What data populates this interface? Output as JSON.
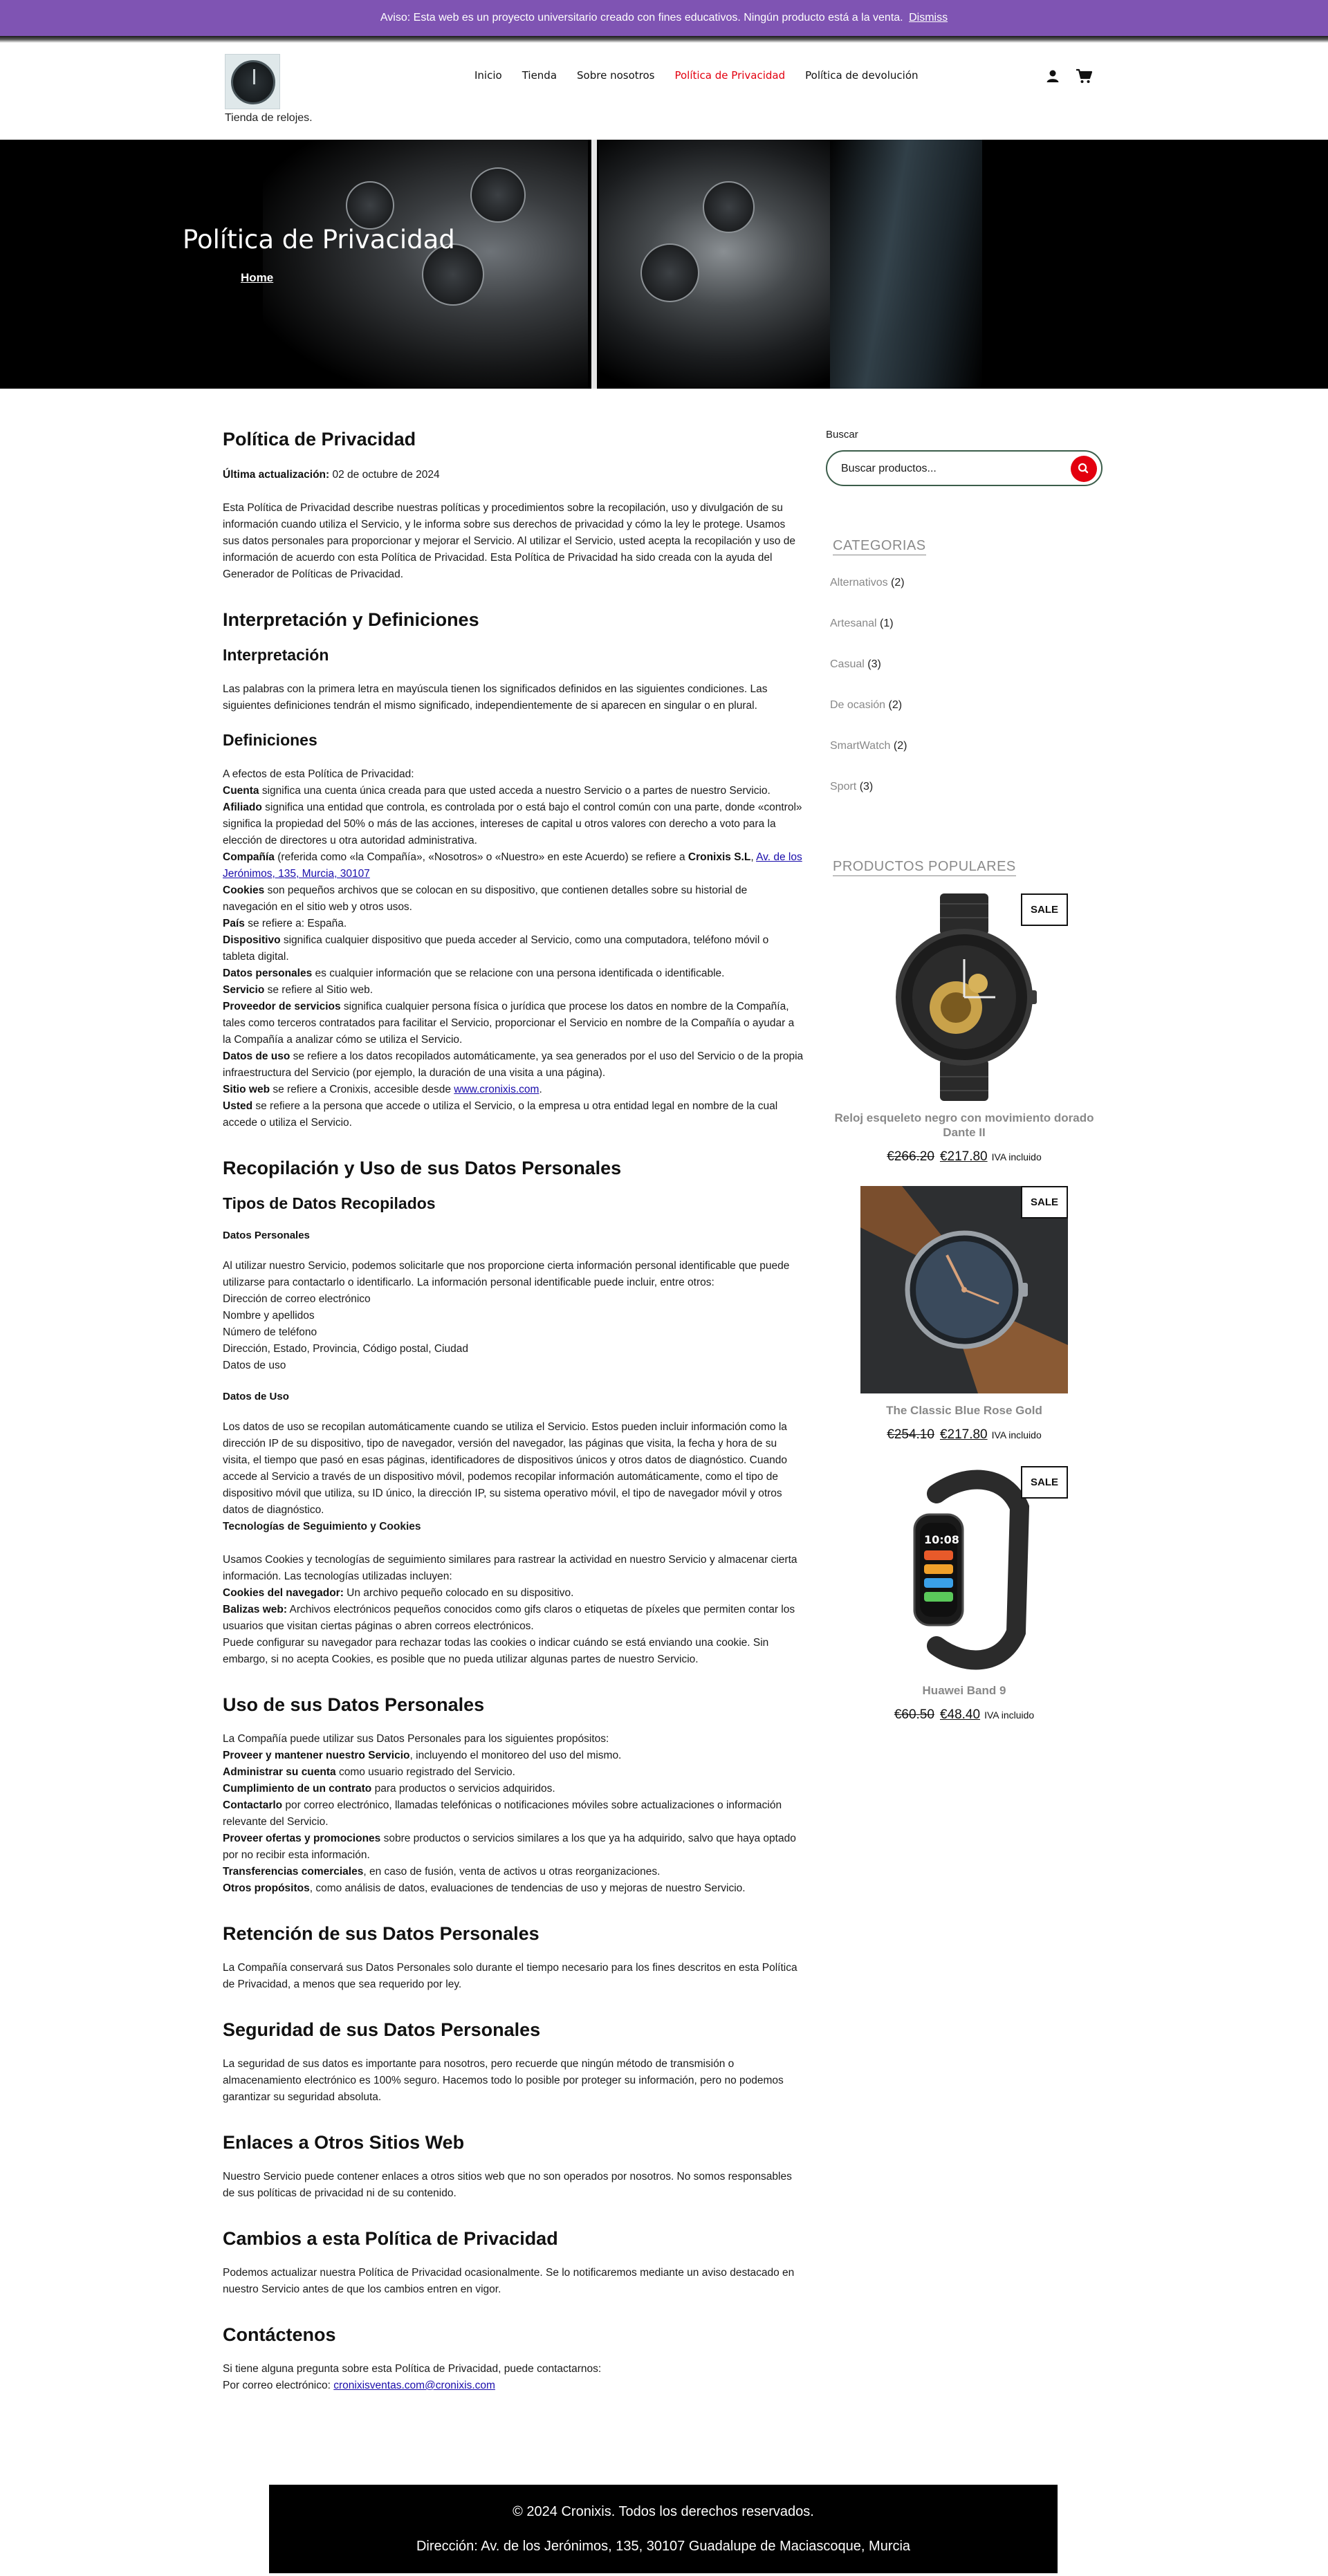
{
  "notice": {
    "text": "Aviso: Esta web es un proyecto universitario creado con fines educativos. Ningún producto está a la venta.",
    "dismiss": "Dismiss"
  },
  "header": {
    "tagline": "Tienda de relojes.",
    "nav": [
      "Inicio",
      "Tienda",
      "Sobre nosotros",
      "Política de Privacidad",
      "Política de devolución"
    ],
    "active_nav": "Política de Privacidad",
    "icons": [
      "user-icon",
      "cart-icon"
    ]
  },
  "hero": {
    "title": "Política de Privacidad",
    "breadcrumb": "Home"
  },
  "article": {
    "title": "Política de Privacidad",
    "last_update_label": "Última actualización:",
    "last_update_value": " 02 de octubre de 2024",
    "intro": "Esta Política de Privacidad describe nuestras políticas y procedimientos sobre la recopilación, uso y divulgación de su información cuando utiliza el Servicio, y le informa sobre sus derechos de privacidad y cómo la ley le protege. Usamos sus datos personales para proporcionar y mejorar el Servicio. Al utilizar el Servicio, usted acepta la recopilación y uso de información de acuerdo con esta Política de Privacidad. Esta Política de Privacidad ha sido creada con la ayuda del Generador de Políticas de Privacidad.",
    "s_interp": "Interpretación y Definiciones",
    "s_interp_sub": "Interpretación",
    "interp_text": "Las palabras con la primera letra en mayúscula tienen los significados definidos en las siguientes condiciones. Las siguientes definiciones tendrán el mismo significado, independientemente de si aparecen en singular o en plural.",
    "s_defs": "Definiciones",
    "defs_intro": "A efectos de esta Política de Privacidad:",
    "defs": {
      "cuenta_t": "Cuenta",
      "cuenta_d": " significa una cuenta única creada para que usted acceda a nuestro Servicio o a partes de nuestro Servicio.",
      "afiliado_t": "Afiliado",
      "afiliado_d": " significa una entidad que controla, es controlada por o está bajo el control común con una parte, donde «control» significa la propiedad del 50% o más de las acciones, intereses de capital u otros valores con derecho a voto para la elección de directores u otra autoridad administrativa.",
      "compania_t": "Compañía",
      "compania_d": " (referida como «la Compañía», «Nosotros» o «Nuestro» en este Acuerdo) se refiere a ",
      "compania_name": "Cronixis S.L",
      "compania_addr": "Av. de los Jerónimos, 135, Murcia, 30107",
      "cookies_t": "Cookies",
      "cookies_d": " son pequeños archivos que se colocan en su dispositivo, que contienen detalles sobre su historial de navegación en el sitio web y otros usos.",
      "pais_t": "País",
      "pais_d": " se refiere a: España.",
      "dispositivo_t": "Dispositivo",
      "dispositivo_d": " significa cualquier dispositivo que pueda acceder al Servicio, como una computadora, teléfono móvil o tableta digital.",
      "datos_t": "Datos personales",
      "datos_d": " es cualquier información que se relacione con una persona identificada o identificable.",
      "servicio_t": "Servicio",
      "servicio_d": " se refiere al Sitio web.",
      "proveedor_t": "Proveedor de servicios",
      "proveedor_d": " significa cualquier persona física o jurídica que procese los datos en nombre de la Compañía, tales como terceros contratados para facilitar el Servicio, proporcionar el Servicio en nombre de la Compañía o ayudar a la Compañía a analizar cómo se utiliza el Servicio.",
      "uso_t": "Datos de uso",
      "uso_d": " se refiere a los datos recopilados automáticamente, ya sea generados por el uso del Servicio o de la propia infraestructura del Servicio (por ejemplo, la duración de una visita a una página).",
      "sitio_t": "Sitio web",
      "sitio_d": " se refiere a Cronixis, accesible desde ",
      "sitio_link": "www.cronixis.com",
      "usted_t": "Usted",
      "usted_d": " se refiere a la persona que accede o utiliza el Servicio, o la empresa u otra entidad legal en nombre de la cual accede o utiliza el Servicio."
    },
    "s_recop": "Recopilación y Uso de sus Datos Personales",
    "s_tipos": "Tipos de Datos Recopilados",
    "s_dp": "Datos Personales",
    "dp_text": "Al utilizar nuestro Servicio, podemos solicitarle que nos proporcione cierta información personal identificable que puede utilizarse para contactarlo o identificarlo. La información personal identificable puede incluir, entre otros:",
    "dp_list": [
      "Dirección de correo electrónico",
      "Nombre y apellidos",
      "Número de teléfono",
      "Dirección, Estado, Provincia, Código postal, Ciudad",
      "Datos de uso"
    ],
    "s_du": "Datos de Uso",
    "du_text": "Los datos de uso se recopilan automáticamente cuando se utiliza el Servicio. Estos pueden incluir información como la dirección IP de su dispositivo, tipo de navegador, versión del navegador, las páginas que visita, la fecha y hora de su visita, el tiempo que pasó en esas páginas, identificadores de dispositivos únicos y otros datos de diagnóstico. Cuando accede al Servicio a través de un dispositivo móvil, podemos recopilar información automáticamente, como el tipo de dispositivo móvil que utiliza, su ID único, la dirección IP, su sistema operativo móvil, el tipo de navegador móvil y otros datos de diagnóstico.",
    "s_track": "Tecnologías de Seguimiento y Cookies",
    "track_text": "Usamos Cookies y tecnologías de seguimiento similares para rastrear la actividad en nuestro Servicio y almacenar cierta información. Las tecnologías utilizadas incluyen:",
    "track_cookies_t": "Cookies del navegador:",
    "track_cookies_d": " Un archivo pequeño colocado en su dispositivo.",
    "track_balizas_t": "Balizas web:",
    "track_balizas_d": " Archivos electrónicos pequeños conocidos como gifs claros o etiquetas de píxeles que permiten contar los usuarios que visitan ciertas páginas o abren correos electrónicos.",
    "track_end": "Puede configurar su navegador para rechazar todas las cookies o indicar cuándo se está enviando una cookie. Sin embargo, si no acepta Cookies, es posible que no pueda utilizar algunas partes de nuestro Servicio.",
    "s_usodatos": "Uso de sus Datos Personales",
    "usodatos_intro": "La Compañía puede utilizar sus Datos Personales para los siguientes propósitos:",
    "usos": {
      "u1_t": "Proveer y mantener nuestro Servicio",
      "u1_d": ", incluyendo el monitoreo del uso del mismo.",
      "u2_t": "Administrar su cuenta",
      "u2_d": " como usuario registrado del Servicio.",
      "u3_t": "Cumplimiento de un contrato",
      "u3_d": " para productos o servicios adquiridos.",
      "u4_t": "Contactarlo",
      "u4_d": " por correo electrónico, llamadas telefónicas o notificaciones móviles sobre actualizaciones o información relevante del Servicio.",
      "u5_t": "Proveer ofertas y promociones",
      "u5_d": " sobre productos o servicios similares a los que ya ha adquirido, salvo que haya optado por no recibir esta información.",
      "u6_t": "Transferencias comerciales",
      "u6_d": ", en caso de fusión, venta de activos u otras reorganizaciones.",
      "u7_t": "Otros propósitos",
      "u7_d": ", como análisis de datos, evaluaciones de tendencias de uso y mejoras de nuestro Servicio."
    },
    "s_reten": "Retención de sus Datos Personales",
    "reten_text": "La Compañía conservará sus Datos Personales solo durante el tiempo necesario para los fines descritos en esta Política de Privacidad, a menos que sea requerido por ley.",
    "s_seg": "Seguridad de sus Datos Personales",
    "seg_text": "La seguridad de sus datos es importante para nosotros, pero recuerde que ningún método de transmisión o almacenamiento electrónico es 100% seguro. Hacemos todo lo posible por proteger su información, pero no podemos garantizar su seguridad absoluta.",
    "s_enl": "Enlaces a Otros Sitios Web",
    "enl_text": "Nuestro Servicio puede contener enlaces a otros sitios web que no son operados por nosotros. No somos responsables de sus políticas de privacidad ni de su contenido.",
    "s_camb": "Cambios a esta Política de Privacidad",
    "camb_text": "Podemos actualizar nuestra Política de Privacidad ocasionalmente. Se lo notificaremos mediante un aviso destacado en nuestro Servicio antes de que los cambios entren en vigor.",
    "s_cont": "Contáctenos",
    "cont_text": "Si tiene alguna pregunta sobre esta Política de Privacidad, puede contactarnos:",
    "cont_email_label": "Por correo electrónico: ",
    "cont_email": "cronixisventas.com@cronixis.com"
  },
  "sidebar": {
    "search_label": "Buscar",
    "search_placeholder": "Buscar productos...",
    "categories_title": "CATEGORIAS",
    "categories": [
      {
        "name": "Alternativos",
        "count": "(2)"
      },
      {
        "name": "Artesanal",
        "count": "(1)"
      },
      {
        "name": "Casual",
        "count": "(3)"
      },
      {
        "name": "De ocasión",
        "count": "(2)"
      },
      {
        "name": "SmartWatch",
        "count": "(2)"
      },
      {
        "name": "Sport",
        "count": "(3)"
      }
    ],
    "popular_title": "PRODUCTOS POPULARES",
    "products": [
      {
        "badge": "SALE",
        "name": "Reloj esqueleto negro con movimiento dorado Dante II",
        "old_price": "€266.20",
        "new_price": "€217.80",
        "tax": "IVA incluido"
      },
      {
        "badge": "SALE",
        "name": "The Classic Blue Rose Gold",
        "old_price": "€254.10",
        "new_price": "€217.80",
        "tax": "IVA incluido"
      },
      {
        "badge": "SALE",
        "name": "Huawei Band 9",
        "old_price": "€60.50",
        "new_price": "€48.40",
        "tax": "IVA incluido"
      }
    ]
  },
  "footer": {
    "copyright": "© 2024 Cronixis. Todos los derechos reservados.",
    "address": "Dirección: Av. de los Jerónimos, 135, 30107 Guadalupe de Maciascoque, Murcia"
  },
  "colors": {
    "notice_bg": "#7f54b3",
    "accent_red": "#e3000f",
    "footer_bg": "#000000",
    "muted_text": "#888888"
  }
}
